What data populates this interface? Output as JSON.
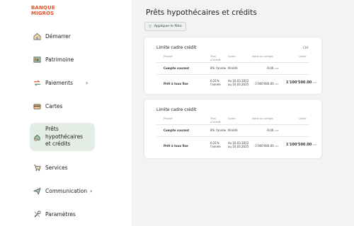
{
  "brand": {
    "line1": "BANQUE",
    "line2": "MIGROS",
    "color": "#e8552b"
  },
  "sidebar": {
    "items": [
      {
        "label": "Démarrer",
        "icon": "home-icon"
      },
      {
        "label": "Patrimoine",
        "icon": "portfolio-icon"
      },
      {
        "label": "Paiements",
        "icon": "transfer-arrows-icon",
        "chevron": "›"
      },
      {
        "label": "Cartes",
        "icon": "card-icon"
      },
      {
        "label": "Prêts hypothécaires et crédits",
        "line1": "Prêts",
        "line2": "hypothécaires",
        "line3": "et crédits",
        "icon": "house-coins-icon",
        "active": true
      },
      {
        "label": "Services",
        "icon": "cart-icon"
      },
      {
        "label": "Communication",
        "icon": "send-icon",
        "chevron": "›"
      },
      {
        "label": "Paramètres",
        "icon": "tools-icon"
      }
    ]
  },
  "main": {
    "title": "Prêts hypothécaires et crédits",
    "filter_label": "Appliquer le filtre",
    "cards": [
      {
        "title": "Limite cadre crédit",
        "currency": "CHF",
        "headers": {
          "product": "Produit",
          "rate_l1": "Taux",
          "rate_l2": "d'intérêt",
          "duration": "Durée",
          "balance": "Solde au compte",
          "limit": "Limite"
        },
        "rows": [
          {
            "product": "Compte courant",
            "rate": "8% l'année",
            "duration_l1": "Illimité",
            "duration_l2": "",
            "balance": "-0.00",
            "balance_cur": "CHF",
            "limit": "",
            "limit_cur": ""
          },
          {
            "product": "Prêt à taux fixe",
            "rate_l1": "0.21%",
            "rate_l2": "l'année",
            "duration_l1": "du 10.03.2022",
            "duration_l2": "au 10.03.2025",
            "balance": "-1'000'000.00",
            "balance_cur": "CHF",
            "limit": "1'100'500.00",
            "limit_cur": "CHF"
          }
        ]
      },
      {
        "title": "Limite cadre crédit",
        "currency": "",
        "headers": {
          "product": "Produit",
          "rate_l1": "Taux",
          "rate_l2": "d'intérêt",
          "duration": "Durée",
          "balance": "Solde au compte",
          "limit": "Limite"
        },
        "rows": [
          {
            "product": "Compte courant",
            "rate": "8% l'année",
            "duration_l1": "Illimité",
            "duration_l2": "",
            "balance": "-0.00",
            "balance_cur": "CHF",
            "limit": "",
            "limit_cur": ""
          },
          {
            "product": "Prêt à taux fixe",
            "rate_l1": "0.21%",
            "rate_l2": "l'année",
            "duration_l1": "du 10.03.2022",
            "duration_l2": "au 10.03.2025",
            "balance": "-1'000'000.00",
            "balance_cur": "CHF",
            "limit": "1'100'500.00",
            "limit_cur": "CHF"
          }
        ]
      }
    ]
  }
}
